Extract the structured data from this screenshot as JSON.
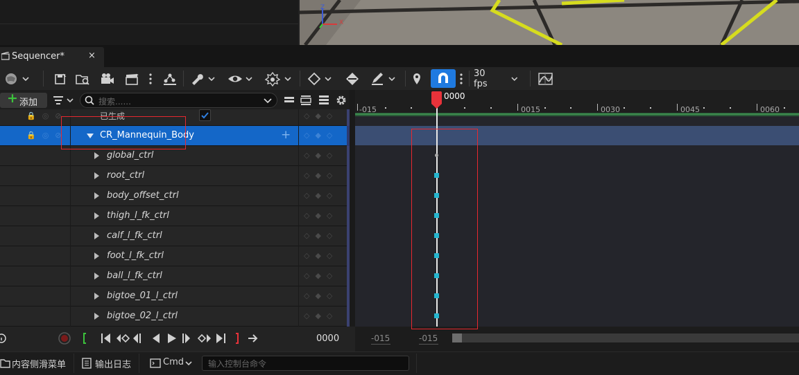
{
  "tab": {
    "title": "Sequencer*",
    "close": "×"
  },
  "toolbar": {
    "fps": "30 fps",
    "icons": [
      "world-icon",
      "save-icon",
      "find-icon",
      "camera-icon",
      "clapper-icon",
      "more-icon",
      "hierarchy-icon",
      "wrench-icon",
      "eye-icon",
      "transform-icon",
      "keyframe-icon",
      "key-diamond-icon",
      "pencil-icon",
      "marker-icon",
      "snap-magnet-icon",
      "curve-editor-icon"
    ]
  },
  "outliner": {
    "add_label": "添加",
    "search_placeholder": "搜索......",
    "rows": [
      {
        "label": "已生成",
        "type": "top"
      },
      {
        "label": "CR_Mannequin_Body",
        "type": "selected"
      },
      {
        "label": "global_ctrl"
      },
      {
        "label": "root_ctrl"
      },
      {
        "label": "body_offset_ctrl"
      },
      {
        "label": "thigh_l_fk_ctrl"
      },
      {
        "label": "calf_l_fk_ctrl"
      },
      {
        "label": "foot_l_fk_ctrl"
      },
      {
        "label": "ball_l_fk_ctrl"
      },
      {
        "label": "bigtoe_01_l_ctrl"
      },
      {
        "label": "bigtoe_02_l_ctrl"
      }
    ]
  },
  "timeline": {
    "playhead_frame": "0000",
    "ruler_labels": [
      "-015",
      "0015",
      "0030",
      "0045",
      "0060"
    ]
  },
  "transport": {
    "current_time": "0000",
    "range_start": "-015",
    "range_view": "-015"
  },
  "statusbar": {
    "content_drawer": "内容侧滑菜单",
    "output_log": "输出日志",
    "cmd": "Cmd",
    "console_placeholder": "输入控制台命令"
  },
  "viewport": {
    "axis_z": "Z",
    "axis_x": "X"
  },
  "colors": {
    "accent": "#1467c8",
    "snap_active": "#1f7ae0",
    "playhead": "#e8323a",
    "keyframe": "#24b5cf",
    "annotation": "#e8282f"
  }
}
